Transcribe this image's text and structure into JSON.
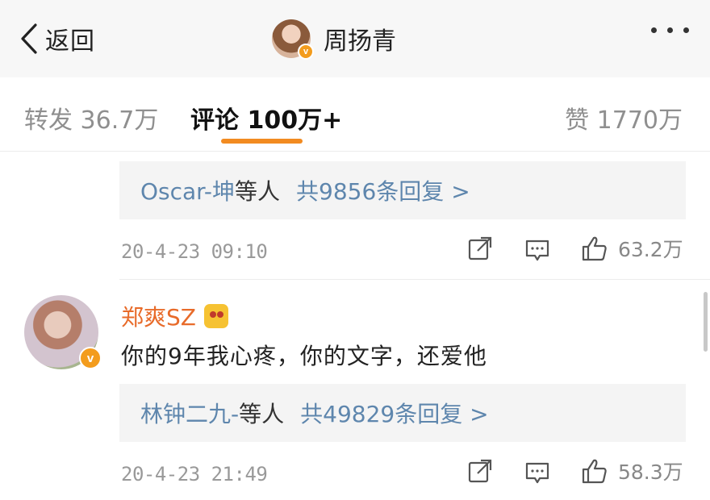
{
  "header": {
    "back_label": "返回",
    "username": "周扬青",
    "verified_badge": "v"
  },
  "tabs": {
    "repost_label": "转发",
    "repost_count": "36.7万",
    "comments_label": "评论",
    "comments_count": "100万+",
    "likes_label": "赞",
    "likes_count": "1770万"
  },
  "comments": [
    {
      "replies": {
        "user": "Oscar-坤",
        "suffix": "等人",
        "count_text": "共9856条回复 >"
      },
      "time": "20-4-23 09:10",
      "likes": "63.2万"
    },
    {
      "username": "郑爽SZ",
      "verified_badge": "v",
      "text": "你的9年我心疼，你的文字，还爱他",
      "replies": {
        "user": "林钟二九-",
        "suffix": "等人",
        "count_text": "共49829条回复 >"
      },
      "time": "20-4-23 21:49",
      "likes": "58.3万"
    }
  ],
  "colors": {
    "accent": "#f28b21",
    "link": "#5e86ad",
    "username": "#e86b2a",
    "verified": "#f39c1d"
  },
  "icons": [
    "chevron-left-icon",
    "more-icon",
    "share-icon",
    "comment-icon",
    "thumbs-up-icon"
  ]
}
